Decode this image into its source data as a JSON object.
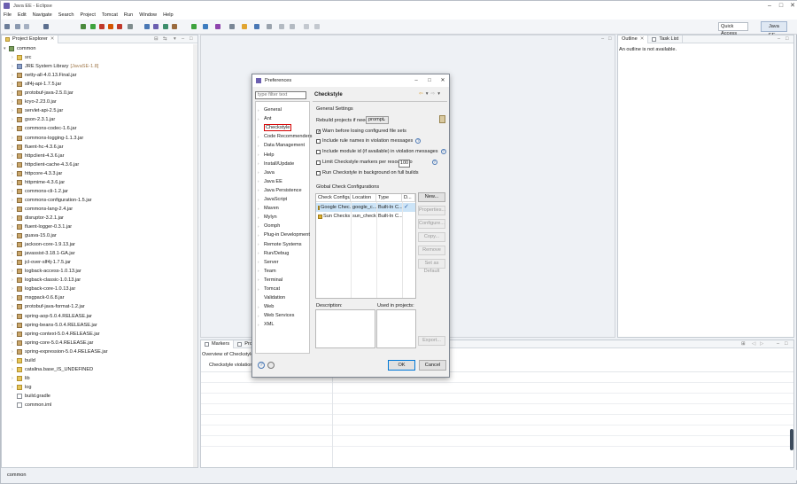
{
  "window": {
    "title": "Java EE - Eclipse"
  },
  "menu": [
    "File",
    "Edit",
    "Navigate",
    "Search",
    "Project",
    "Tomcat",
    "Run",
    "Window",
    "Help"
  ],
  "toolbar": {
    "quick_access": "Quick Access",
    "perspective": "Java EE"
  },
  "project_explorer": {
    "tab": "Project Explorer",
    "tree": [
      {
        "label": "common",
        "icon": "project-icon",
        "indent": 0,
        "expanded": true
      },
      {
        "label": "src",
        "icon": "folder-icon",
        "indent": 1
      },
      {
        "label": "JRE System Library",
        "suffix": "[JavaSE-1.8]",
        "icon": "library-icon",
        "indent": 1
      },
      {
        "label": "netty-all-4.0.13.Final.jar",
        "icon": "jar-icon",
        "indent": 1
      },
      {
        "label": "slf4j-api-1.7.5.jar",
        "icon": "jar-icon",
        "indent": 1
      },
      {
        "label": "protobuf-java-2.5.0.jar",
        "icon": "jar-icon",
        "indent": 1
      },
      {
        "label": "kryo-2.23.0.jar",
        "icon": "jar-icon",
        "indent": 1
      },
      {
        "label": "servlet-api-2.5.jar",
        "icon": "jar-icon",
        "indent": 1
      },
      {
        "label": "gson-2.3.1.jar",
        "icon": "jar-icon",
        "indent": 1
      },
      {
        "label": "commons-codec-1.6.jar",
        "icon": "jar-icon",
        "indent": 1
      },
      {
        "label": "commons-logging-1.1.3.jar",
        "icon": "jar-icon",
        "indent": 1
      },
      {
        "label": "fluent-hc-4.3.6.jar",
        "icon": "jar-icon",
        "indent": 1
      },
      {
        "label": "httpclient-4.3.6.jar",
        "icon": "jar-icon",
        "indent": 1
      },
      {
        "label": "httpclient-cache-4.3.6.jar",
        "icon": "jar-icon",
        "indent": 1
      },
      {
        "label": "httpcore-4.3.3.jar",
        "icon": "jar-icon",
        "indent": 1
      },
      {
        "label": "httpmime-4.3.6.jar",
        "icon": "jar-icon",
        "indent": 1
      },
      {
        "label": "commons-cli-1.2.jar",
        "icon": "jar-icon",
        "indent": 1
      },
      {
        "label": "commons-configuration-1.5.jar",
        "icon": "jar-icon",
        "indent": 1
      },
      {
        "label": "commons-lang-2.4.jar",
        "icon": "jar-icon",
        "indent": 1
      },
      {
        "label": "disruptor-3.2.1.jar",
        "icon": "jar-icon",
        "indent": 1
      },
      {
        "label": "fluent-logger-0.3.1.jar",
        "icon": "jar-icon",
        "indent": 1
      },
      {
        "label": "guava-15.0.jar",
        "icon": "jar-icon",
        "indent": 1
      },
      {
        "label": "jackson-core-1.9.13.jar",
        "icon": "jar-icon",
        "indent": 1
      },
      {
        "label": "javassist-3.18.1-GA.jar",
        "icon": "jar-icon",
        "indent": 1
      },
      {
        "label": "jcl-over-slf4j-1.7.5.jar",
        "icon": "jar-icon",
        "indent": 1
      },
      {
        "label": "logback-access-1.0.13.jar",
        "icon": "jar-icon",
        "indent": 1
      },
      {
        "label": "logback-classic-1.0.13.jar",
        "icon": "jar-icon",
        "indent": 1
      },
      {
        "label": "logback-core-1.0.13.jar",
        "icon": "jar-icon",
        "indent": 1
      },
      {
        "label": "msgpack-0.6.8.jar",
        "icon": "jar-icon",
        "indent": 1
      },
      {
        "label": "protobuf-java-format-1.2.jar",
        "icon": "jar-icon",
        "indent": 1
      },
      {
        "label": "spring-aop-5.0.4.RELEASE.jar",
        "icon": "jar-icon",
        "indent": 1
      },
      {
        "label": "spring-beans-5.0.4.RELEASE.jar",
        "icon": "jar-icon",
        "indent": 1
      },
      {
        "label": "spring-context-5.0.4.RELEASE.jar",
        "icon": "jar-icon",
        "indent": 1
      },
      {
        "label": "spring-core-5.0.4.RELEASE.jar",
        "icon": "jar-icon",
        "indent": 1
      },
      {
        "label": "spring-expression-5.0.4.RELEASE.jar",
        "icon": "jar-icon",
        "indent": 1
      },
      {
        "label": "build",
        "icon": "folder-icon",
        "indent": 1
      },
      {
        "label": "catalina.base_IS_UNDEFINED",
        "icon": "folder-icon",
        "indent": 1
      },
      {
        "label": "lib",
        "icon": "folder-icon",
        "indent": 1
      },
      {
        "label": "log",
        "icon": "folder-icon",
        "indent": 1
      },
      {
        "label": "build.gradle",
        "icon": "file-icon",
        "indent": 1,
        "leaf": true
      },
      {
        "label": "common.iml",
        "icon": "file-icon",
        "indent": 1,
        "leaf": true
      }
    ]
  },
  "outline": {
    "tab_outline": "Outline",
    "tab_tasks": "Task List",
    "message": "An outline is not available."
  },
  "bottom": {
    "tab_markers": "Markers",
    "tab_properties": "Properties",
    "header": "Overview of Checkstyle viola",
    "label": "Checkstyle violation typ"
  },
  "status_bar": "common",
  "dialog": {
    "title": "Preferences",
    "filter_placeholder": "type filter text",
    "nav": [
      {
        "label": "General",
        "arrow": true
      },
      {
        "label": "Ant",
        "arrow": true
      },
      {
        "label": "Checkstyle",
        "arrow": false,
        "selected": true
      },
      {
        "label": "Code Recommenders",
        "arrow": true
      },
      {
        "label": "Data Management",
        "arrow": true
      },
      {
        "label": "Help",
        "arrow": true
      },
      {
        "label": "Install/Update",
        "arrow": true
      },
      {
        "label": "Java",
        "arrow": true
      },
      {
        "label": "Java EE",
        "arrow": true
      },
      {
        "label": "Java Persistence",
        "arrow": true
      },
      {
        "label": "JavaScript",
        "arrow": true
      },
      {
        "label": "Maven",
        "arrow": true
      },
      {
        "label": "Mylyn",
        "arrow": true
      },
      {
        "label": "Oomph",
        "arrow": true
      },
      {
        "label": "Plug-in Development",
        "arrow": true
      },
      {
        "label": "Remote Systems",
        "arrow": true
      },
      {
        "label": "Run/Debug",
        "arrow": true
      },
      {
        "label": "Server",
        "arrow": true
      },
      {
        "label": "Team",
        "arrow": true
      },
      {
        "label": "Terminal",
        "arrow": true
      },
      {
        "label": "Tomcat",
        "arrow": true
      },
      {
        "label": "Validation",
        "arrow": false
      },
      {
        "label": "Web",
        "arrow": true
      },
      {
        "label": "Web Services",
        "arrow": true
      },
      {
        "label": "XML",
        "arrow": true
      }
    ],
    "page_title": "Checkstyle",
    "general_settings": "General Settings",
    "rebuild_label": "Rebuild projects if needed:",
    "rebuild_value": "prompt",
    "options": [
      {
        "label": "Warn before losing configured file sets",
        "checked": true,
        "help": false
      },
      {
        "label": "Include rule names in violation messages",
        "checked": false,
        "help": true
      },
      {
        "label": "Include module id (if available) in violation messages",
        "checked": false,
        "help": true
      },
      {
        "label": "Limit Checkstyle markers per resource to",
        "checked": false,
        "help": true
      },
      {
        "label": "Run Checkstyle in background on full builds",
        "checked": false,
        "help": false
      }
    ],
    "limit_value": "100",
    "global_configs": "Global Check Configurations",
    "columns": [
      "Check Configur...",
      "Location",
      "Type",
      "D..."
    ],
    "rows": [
      {
        "name": "Google Chec...",
        "location": "google_c...",
        "type": "Built-In C...",
        "default": "✓"
      },
      {
        "name": "Sun Checks",
        "location": "sun_check...",
        "type": "Built-In C...",
        "default": ""
      }
    ],
    "side_buttons": [
      {
        "label": "New...",
        "enabled": true
      },
      {
        "label": "Properties...",
        "enabled": false
      },
      {
        "label": "Configure...",
        "enabled": false
      },
      {
        "label": "Copy...",
        "enabled": false
      },
      {
        "label": "Remove",
        "enabled": false
      },
      {
        "label": "Set as Default",
        "enabled": false
      }
    ],
    "description_label": "Description:",
    "used_in_label": "Used in projects:",
    "export_label": "Export...",
    "ok_label": "OK",
    "cancel_label": "Cancel"
  },
  "colors": {
    "selection_outline": "#d40000",
    "selected_row": "#cce4f7",
    "accent": "#0078d7"
  }
}
